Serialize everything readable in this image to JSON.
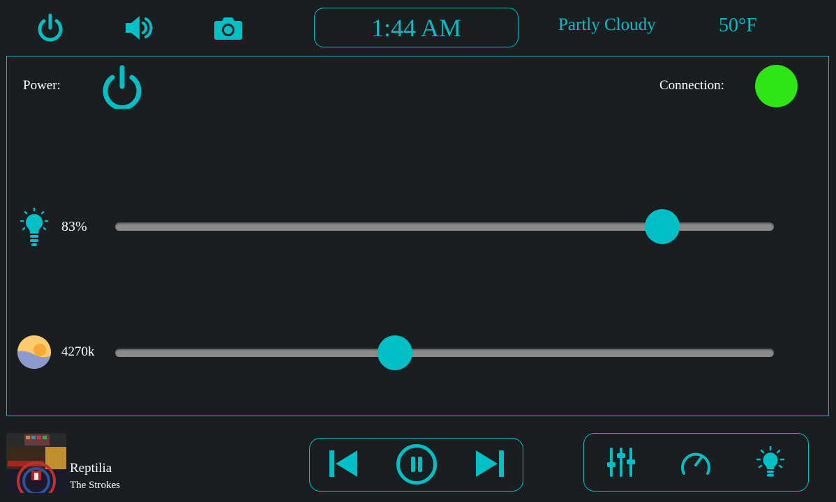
{
  "header": {
    "time": "1:44 AM",
    "weather_condition": "Partly Cloudy",
    "weather_temp": "50°F",
    "icons": [
      "power-icon",
      "volume-icon",
      "camera-icon"
    ]
  },
  "panel": {
    "power_label": "Power:",
    "connection_label": "Connection:",
    "connection_status_color": "#2ee613",
    "brightness": {
      "label": "83%",
      "value_percent": 83
    },
    "color_temp": {
      "label": "4270k",
      "value_fraction": 0.425
    }
  },
  "now_playing": {
    "title": "Reptilia",
    "artist": "The Strokes"
  },
  "colors": {
    "accent": "#00c0c6",
    "background": "#1b1e20",
    "track": "#8a8a8a"
  }
}
